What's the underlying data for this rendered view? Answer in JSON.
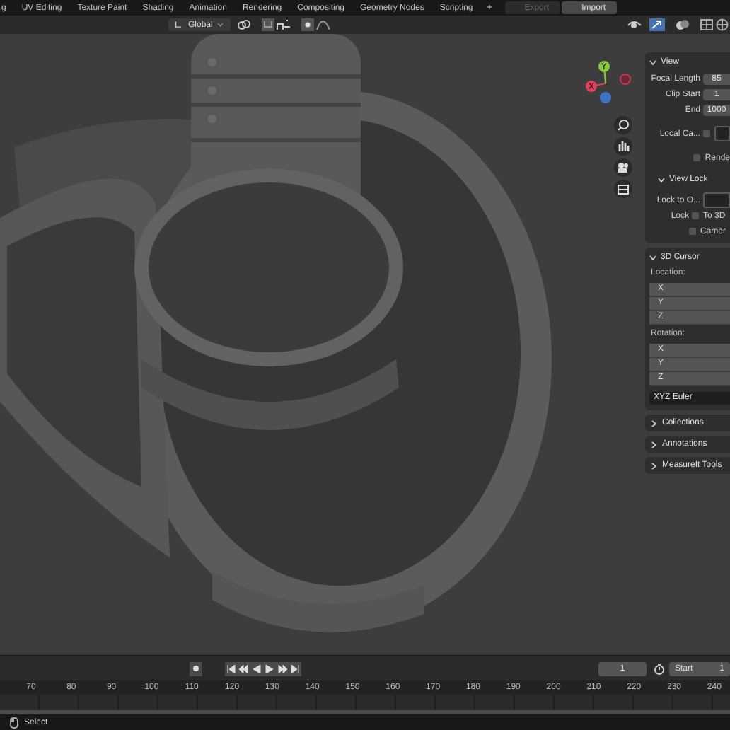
{
  "workspace_tabs": [
    {
      "label": "g",
      "selected": false
    },
    {
      "label": "UV Editing",
      "selected": false
    },
    {
      "label": "Texture Paint",
      "selected": false
    },
    {
      "label": "Shading",
      "selected": false
    },
    {
      "label": "Animation",
      "selected": false
    },
    {
      "label": "Rendering",
      "selected": false
    },
    {
      "label": "Compositing",
      "selected": false
    },
    {
      "label": "Geometry Nodes",
      "selected": false
    },
    {
      "label": "Scripting",
      "selected": false
    }
  ],
  "add_tab": "+",
  "top_buttons": [
    {
      "label": "Export",
      "disabled": true
    },
    {
      "label": "Import",
      "disabled": false
    }
  ],
  "header": {
    "orientation": "Global"
  },
  "gizmo": {
    "x": "X",
    "y": "Y"
  },
  "sidebar": {
    "view": {
      "title": "View",
      "expanded": true,
      "fields": [
        {
          "label": "Focal Length",
          "value": "85"
        },
        {
          "label": "Clip Start",
          "value": "1"
        },
        {
          "label": "End",
          "value": "1000"
        }
      ],
      "local_camera": {
        "label": "Local Ca...",
        "checked": false
      },
      "render_region": {
        "label": "Rende",
        "checked": false
      },
      "view_lock": {
        "title": "View Lock",
        "expanded": true,
        "lock_to": "Lock to O...",
        "lock_label": "Lock",
        "options": [
          {
            "label": "To 3D",
            "checked": false
          },
          {
            "label": "Camer",
            "checked": false
          }
        ]
      }
    },
    "cursor": {
      "title": "3D Cursor",
      "expanded": true,
      "location_label": "Location:",
      "location": [
        "X",
        "Y",
        "Z"
      ],
      "rotation_label": "Rotation:",
      "rotation": [
        "X",
        "Y",
        "Z"
      ],
      "rotation_mode": "XYZ Euler"
    },
    "collapsed_panels": [
      {
        "title": "Collections",
        "expanded": false
      },
      {
        "title": "Annotations",
        "expanded": false
      },
      {
        "title": "MeasureIt Tools",
        "expanded": false
      }
    ]
  },
  "timeline": {
    "current_frame": "1",
    "start_label": "Start",
    "start_value": "1",
    "ruler": [
      "70",
      "80",
      "90",
      "100",
      "110",
      "120",
      "130",
      "140",
      "150",
      "160",
      "170",
      "180",
      "190",
      "200",
      "210",
      "220",
      "230",
      "240"
    ]
  },
  "status_bar": {
    "action": "Select"
  }
}
